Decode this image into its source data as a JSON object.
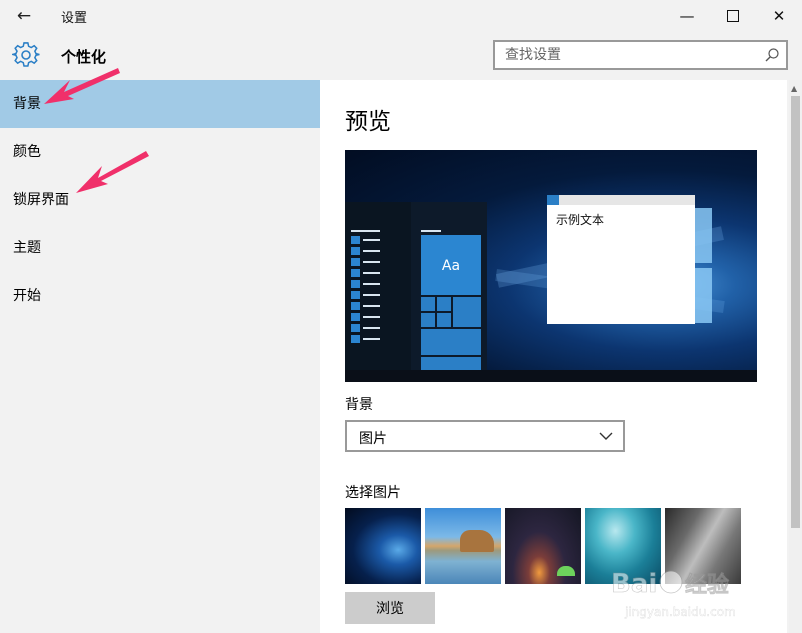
{
  "window": {
    "title": "设置",
    "back_icon": "←",
    "minimize_icon": "—",
    "close_icon": "✕"
  },
  "header": {
    "section_title": "个性化",
    "search": {
      "placeholder": "查找设置"
    }
  },
  "sidebar": {
    "items": [
      {
        "label": "背景",
        "active": true
      },
      {
        "label": "颜色",
        "active": false
      },
      {
        "label": "锁屏界面",
        "active": false
      },
      {
        "label": "主题",
        "active": false
      },
      {
        "label": "开始",
        "active": false
      }
    ]
  },
  "main": {
    "preview_heading": "预览",
    "preview": {
      "tile_label": "Aa",
      "sample_text": "示例文本"
    },
    "background_label": "背景",
    "background_select": {
      "value": "图片"
    },
    "choose_picture_label": "选择图片",
    "pictures": [
      {
        "name": "windows-hero"
      },
      {
        "name": "beach-rock-arch"
      },
      {
        "name": "night-sky-tent"
      },
      {
        "name": "underwater-swimmer"
      },
      {
        "name": "rock-cliff"
      }
    ],
    "browse_label": "浏览"
  },
  "watermark": {
    "text": "Bai 经验",
    "url_text": "jingyan.baidu.com"
  },
  "colors": {
    "accent": "#2b7fc6",
    "sidebar_selected": "#a1cae6",
    "annotation_arrow": "#f0306a"
  }
}
